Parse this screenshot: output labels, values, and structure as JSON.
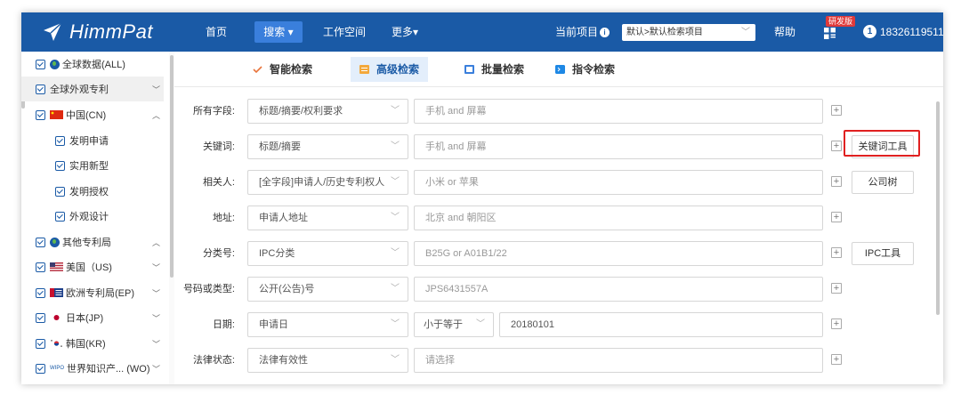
{
  "brand": {
    "name": "HimmPat"
  },
  "topnav": {
    "home": "首页",
    "search": "搜索",
    "workspace": "工作空间",
    "more": "更多",
    "current_project_label": "当前项目",
    "project_value": "默认>默认检索项目",
    "help": "帮助",
    "dev_badge": "研发版",
    "user_badge": "1",
    "user_phone": "18326119511"
  },
  "sidebar": {
    "items": [
      {
        "label": "全球数据(ALL)",
        "icon": "globe-icon"
      },
      {
        "label": "全球外观专利",
        "icon": ""
      },
      {
        "label": "中国(CN)",
        "icon": "flag-cn"
      },
      {
        "label": "发明申请",
        "icon": ""
      },
      {
        "label": "实用新型",
        "icon": ""
      },
      {
        "label": "发明授权",
        "icon": ""
      },
      {
        "label": "外观设计",
        "icon": ""
      },
      {
        "label": "其他专利局",
        "icon": "globe-icon"
      },
      {
        "label": "美国（US)",
        "icon": "flag-us"
      },
      {
        "label": "欧洲专利局(EP)",
        "icon": "flag-ep"
      },
      {
        "label": "日本(JP)",
        "icon": "flag-jp"
      },
      {
        "label": "韩国(KR)",
        "icon": "flag-kr"
      },
      {
        "label": "世界知识产... (WO)",
        "icon": "wipo-icon",
        "icon_text": "WIPO"
      }
    ]
  },
  "tabs": [
    {
      "label": "智能检索",
      "icon": "smart-search-icon"
    },
    {
      "label": "高级检索",
      "icon": "advanced-search-icon"
    },
    {
      "label": "批量检索",
      "icon": "batch-search-icon"
    },
    {
      "label": "指令检索",
      "icon": "command-search-icon"
    }
  ],
  "form": {
    "rows": [
      {
        "label": "所有字段:",
        "select": "标题/摘要/权利要求",
        "placeholder": "手机 and 屏幕"
      },
      {
        "label": "关键词:",
        "select": "标题/摘要",
        "placeholder": "手机 and 屏幕",
        "tool": "关键词工具"
      },
      {
        "label": "相关人:",
        "select": "[全字段]申请人/历史专利权人",
        "placeholder": "小米 or 苹果",
        "tool": "公司树"
      },
      {
        "label": "地址:",
        "select": "申请人地址",
        "placeholder": "北京 and 朝阳区"
      },
      {
        "label": "分类号:",
        "select": "IPC分类",
        "placeholder": "B25G or A01B1/22",
        "tool": "IPC工具"
      },
      {
        "label": "号码或类型:",
        "select": "公开(公告)号",
        "placeholder": "JPS6431557A"
      },
      {
        "label": "日期:",
        "select": "申请日",
        "operator": "小于等于",
        "value": "20180101"
      },
      {
        "label": "法律状态:",
        "select": "法律有效性",
        "placeholder": "请选择"
      }
    ]
  },
  "colors": {
    "topbar": "#1a5aa6",
    "accent": "#3a7fdc",
    "highlight": "#e02020"
  }
}
